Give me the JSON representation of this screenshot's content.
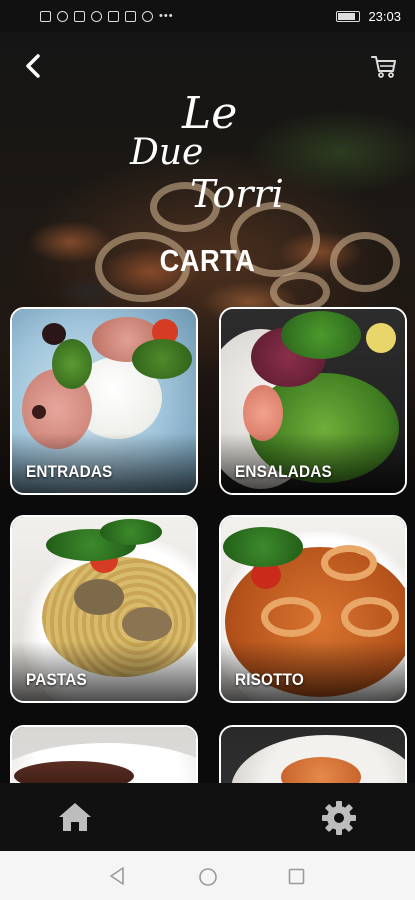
{
  "status_bar": {
    "time": "23:03"
  },
  "header": {
    "back_icon": "chevron-left-icon",
    "cart_icon": "cart-icon"
  },
  "logo": {
    "line1": "Le",
    "line2": "Due",
    "line3": "Torri"
  },
  "page": {
    "title": "CARTA"
  },
  "categories": [
    {
      "label": "ENTRADAS"
    },
    {
      "label": "ENSALADAS"
    },
    {
      "label": "PASTAS"
    },
    {
      "label": "RISOTTO"
    }
  ],
  "bottom_nav": {
    "home_icon": "home-icon",
    "settings_icon": "gear-icon"
  },
  "colors": {
    "background": "#0b0b0b",
    "card_border": "#ffffff",
    "nav_bg": "#111111",
    "system_nav_bg": "#f5f5f5"
  }
}
